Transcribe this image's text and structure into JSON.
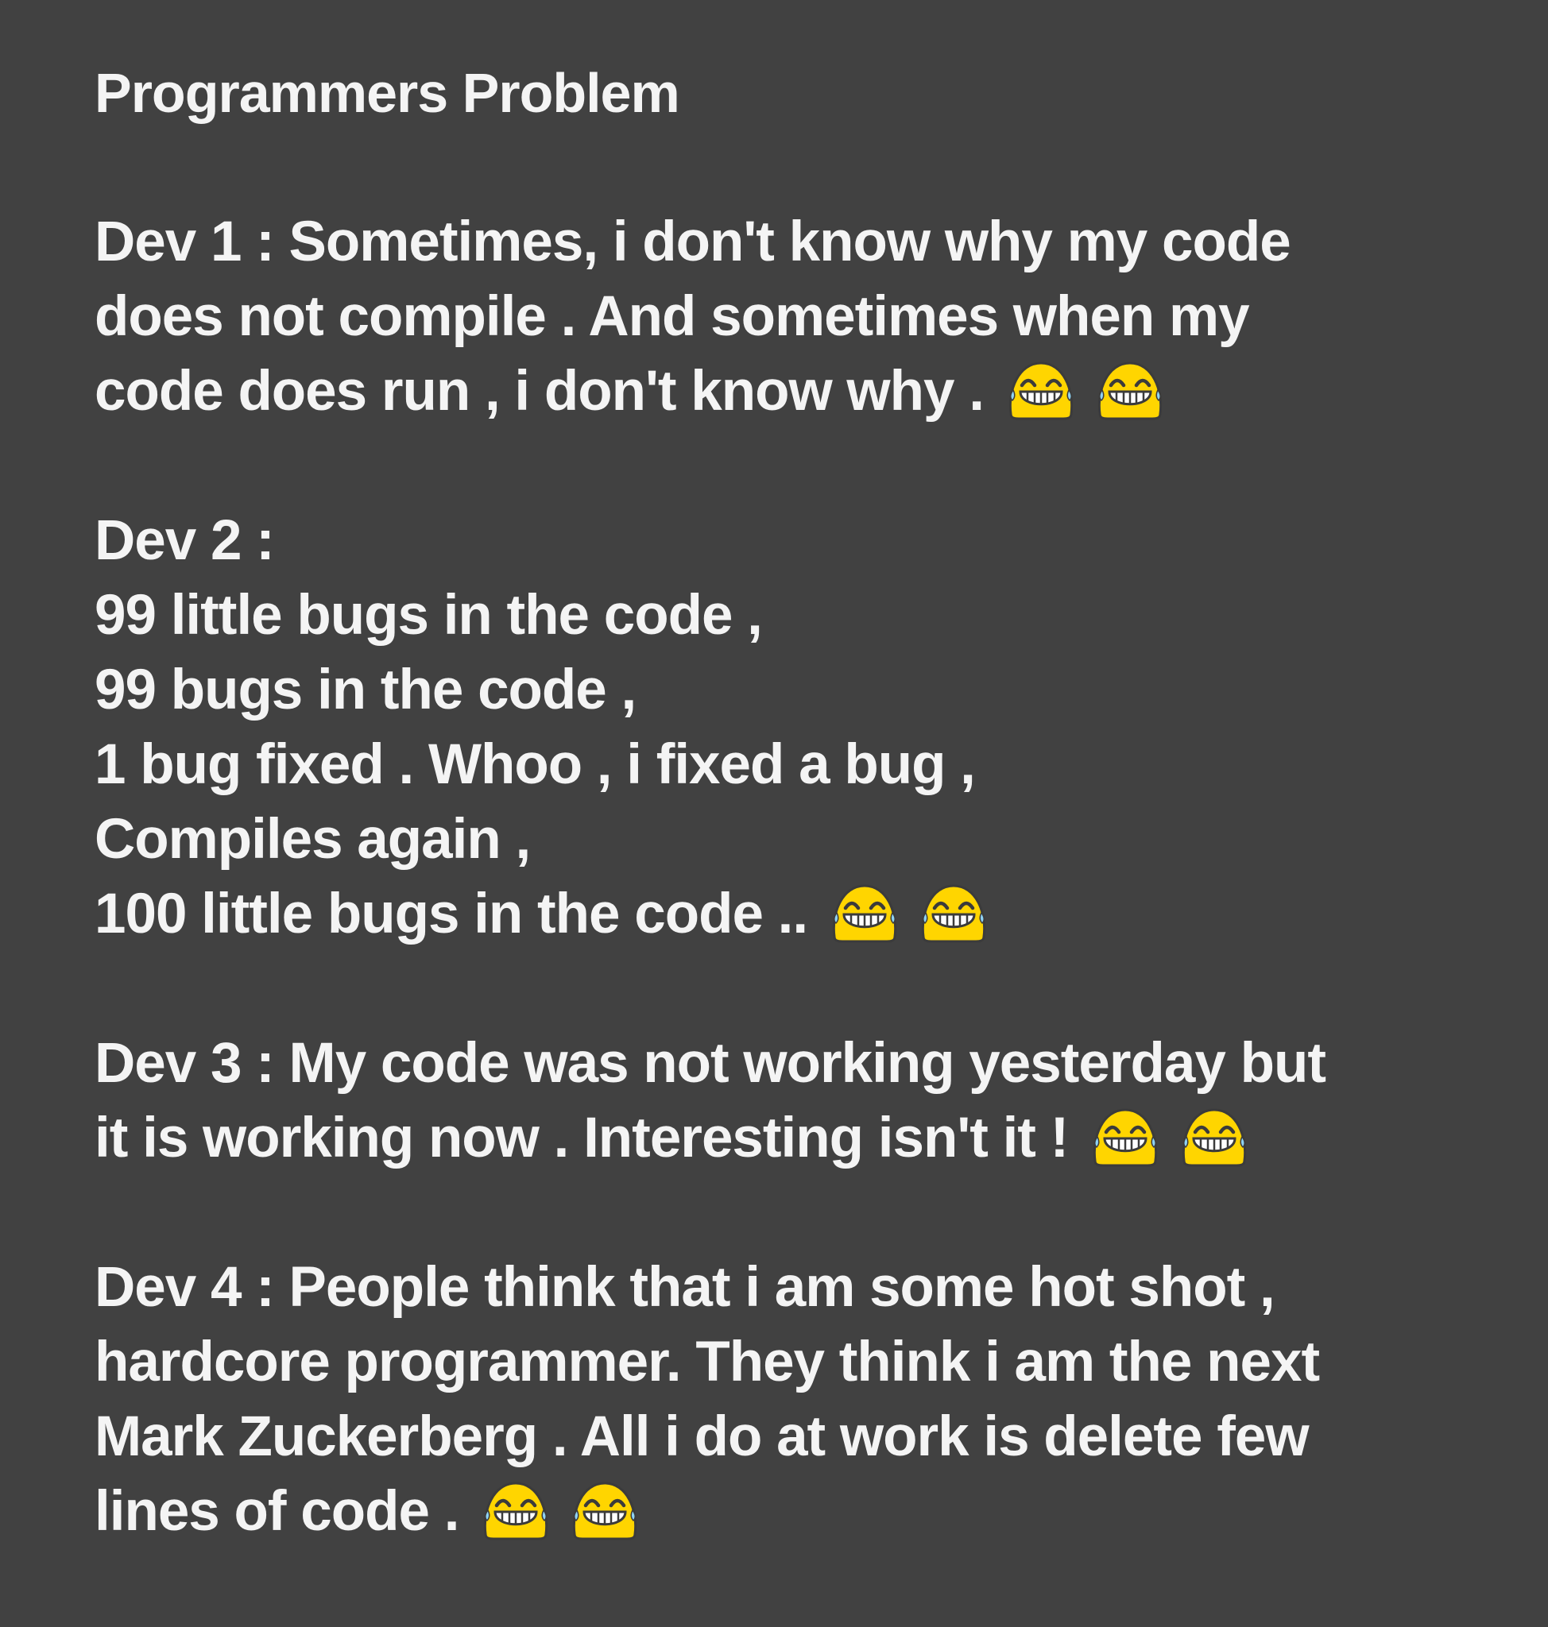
{
  "post": {
    "title": "Programmers Problem",
    "sections": [
      {
        "lines": [
          "Dev 1 : Sometimes, i don't know why my code",
          "does not compile . And sometimes when my",
          "code does run , i don't know why ."
        ]
      },
      {
        "lines": [
          "Dev 2 :",
          "99 little bugs in the code ,",
          "99 bugs in the code ,",
          "1 bug fixed . Whoo , i fixed a bug ,",
          "Compiles again ,",
          "100 little bugs in the code .."
        ]
      },
      {
        "lines": [
          "Dev 3 : My code was not working yesterday but",
          "it is working now . Interesting isn't it !"
        ]
      },
      {
        "lines": [
          "Dev 4 : People think that i am some hot shot ,",
          "hardcore programmer. They think i am the next",
          "Mark Zuckerberg . All i do at work is delete few",
          "lines of code ."
        ]
      }
    ],
    "emoji": {
      "name": "grinning-face-with-tears-of-joy-icon",
      "count_per_line": 2,
      "face_color": "#FFD500",
      "outline_color": "#3B3B3B",
      "tear_color": "#8FD3F5"
    }
  },
  "colors": {
    "background": "#414141",
    "text": "#F4F4F4"
  }
}
